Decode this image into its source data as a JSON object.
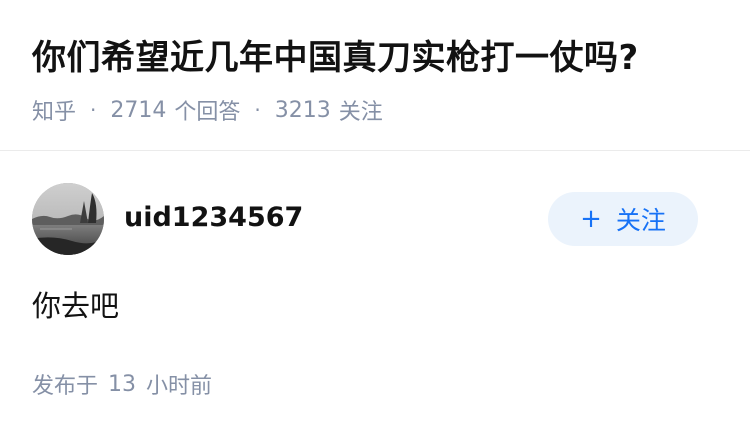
{
  "question": {
    "title": "你们希望近几年中国真刀实枪打一仗吗?",
    "source": "知乎",
    "separator": "·",
    "answer_count": "2714",
    "answer_label": "个回答",
    "follow_count": "3213",
    "follow_label": "关注"
  },
  "answer": {
    "author_name": "uid1234567",
    "follow_button_icon": "+",
    "follow_button_label": "关注",
    "content": "你去吧",
    "published_prefix": "发布于",
    "published_num": "13",
    "published_unit": "小时前"
  },
  "colors": {
    "title": "#121212",
    "meta": "#8590a6",
    "accent": "#1772f6",
    "follow_bg": "#ebf3fc",
    "divider": "#ebebeb"
  }
}
